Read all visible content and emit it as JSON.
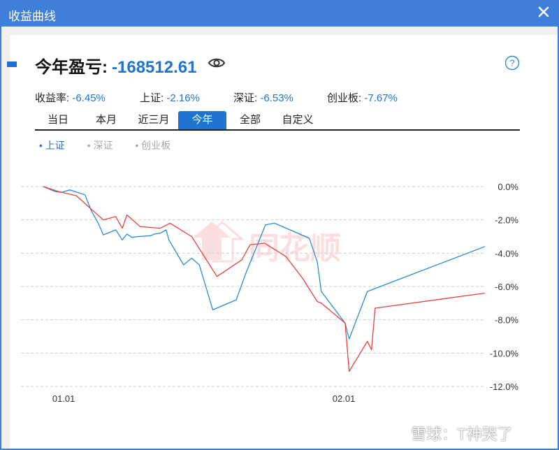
{
  "window": {
    "title": "收益曲线"
  },
  "header": {
    "label": "今年盈亏:",
    "value": "-168512.61"
  },
  "stats": [
    {
      "label": "收益率:",
      "value": "-6.45%"
    },
    {
      "label": "上证:",
      "value": "-2.16%"
    },
    {
      "label": "深证:",
      "value": "-6.53%"
    },
    {
      "label": "创业板:",
      "value": "-7.67%"
    }
  ],
  "tabs": [
    "当日",
    "本月",
    "近三月",
    "今年",
    "全部",
    "自定义"
  ],
  "active_tab": "今年",
  "legend": [
    "上证",
    "深证",
    "创业板"
  ],
  "watermark": {
    "center": "同花顺",
    "corner": "雪球：T神哭了"
  },
  "colors": {
    "accent": "#1e74cf",
    "portfolio": "#e8403d",
    "index": "#2a8bd8",
    "titlebar": "#3f7fd9"
  },
  "chart_data": {
    "type": "line",
    "x_ticks": [
      "01.01",
      "02.01"
    ],
    "y_ticks": [
      "0.0%",
      "-2.0%",
      "-4.0%",
      "-6.0%",
      "-8.0%",
      "-10.0%",
      "-12.0%"
    ],
    "ylim": [
      -12,
      0
    ],
    "grid": true,
    "series": [
      {
        "name": "上证",
        "color": "#2a8bd8",
        "x": [
          0,
          0.85,
          1.32,
          1.92,
          3.02,
          3.45,
          3.98,
          4.35,
          5.25,
          5.72,
          6.06,
          6.42,
          6.86,
          7.78,
          8.05,
          8.48,
          8.9,
          9.1,
          10.16,
          10.75,
          11.3,
          11.88,
          12.28,
          13.98,
          14.68,
          16.1,
          16.75,
          19.27,
          19.85,
          20.14,
          21.87,
          22.16,
          23.48,
          32.0
        ],
        "y": [
          0,
          -0.3,
          -0.35,
          -0.2,
          -0.5,
          -1.4,
          -2.2,
          -2.9,
          -2.6,
          -3.2,
          -2.85,
          -3.05,
          -3.0,
          -2.95,
          -2.85,
          -2.8,
          -2.6,
          -3.2,
          -4.7,
          -4.3,
          -4.7,
          -6.3,
          -7.4,
          -6.8,
          -5.2,
          -2.3,
          -2.2,
          -3.1,
          -4.5,
          -6.3,
          -8.2,
          -9.15,
          -6.3,
          -3.6
        ]
      },
      {
        "name": "今年盈亏",
        "color": "#e8403d",
        "x": [
          0,
          1.1,
          2.4,
          3.4,
          4.35,
          5.25,
          5.72,
          6.06,
          7.0,
          7.7,
          8.48,
          9.18,
          10.75,
          12.58,
          14.38,
          14.98,
          16.03,
          17.58,
          18.78,
          19.85,
          20.14,
          21.87,
          22.16,
          23.48,
          23.78,
          24.04,
          32.0
        ],
        "y": [
          0,
          -0.3,
          -0.55,
          -1.3,
          -2.0,
          -1.8,
          -2.5,
          -1.7,
          -2.4,
          -2.45,
          -2.5,
          -2.2,
          -3.0,
          -5.4,
          -4.4,
          -3.5,
          -3.4,
          -4.2,
          -5.5,
          -6.9,
          -7.0,
          -8.2,
          -11.1,
          -9.3,
          -9.8,
          -7.3,
          -6.4
        ]
      }
    ]
  }
}
